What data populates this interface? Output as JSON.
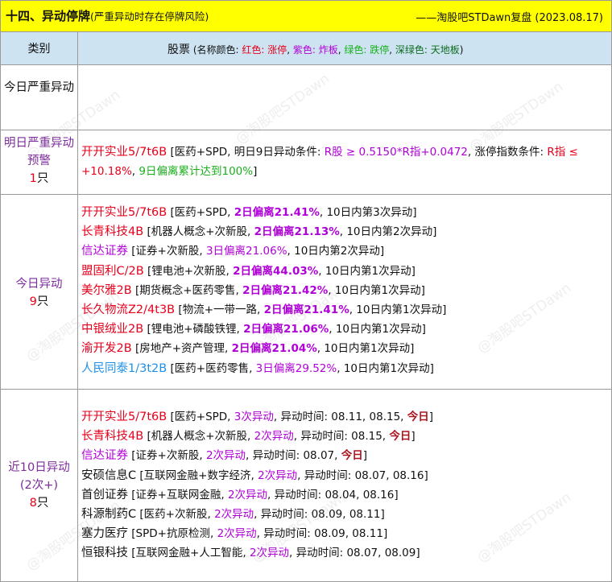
{
  "title": {
    "main": "十四、异动停牌",
    "sub": "(严重异动时存在停牌风险)",
    "source": "——淘股吧STDawn复盘 (2023.08.17)"
  },
  "header": {
    "category": "类别",
    "stocks": "股票",
    "legend": [
      {
        "text": " (名称颜色: ",
        "color": "#111111"
      },
      {
        "text": "红色: 涨停",
        "color": "#e8001b"
      },
      {
        "text": ", ",
        "color": "#111111"
      },
      {
        "text": "紫色: 炸板",
        "color": "#b000d8"
      },
      {
        "text": ", ",
        "color": "#111111"
      },
      {
        "text": "绿色: 跌停",
        "color": "#18b01a"
      },
      {
        "text": ", ",
        "color": "#111111"
      },
      {
        "text": "深绿色: 天地板",
        "color": "#0d6b1e"
      },
      {
        "text": ")",
        "color": "#111111"
      }
    ]
  },
  "watermark": "@淘股吧STDawn",
  "colors": {
    "red": "#e8001b",
    "purple": "#b000d8",
    "green": "#18b01a",
    "cyan": "#1e90e8",
    "dark": "#111111",
    "title_bg": "#ffff00",
    "header_bg": "#cde3f2"
  },
  "sections": [
    {
      "id": "today-severe",
      "category": [
        {
          "text": "今日严重异动",
          "color": "#111111"
        }
      ],
      "lines": []
    },
    {
      "id": "tomorrow-severe",
      "category": [
        {
          "text": "明日严重异动预警",
          "color": "#7d2c9d"
        },
        {
          "text": "\n1",
          "color": "#e8001b"
        },
        {
          "text": "只",
          "color": "#111111"
        }
      ],
      "lines": [
        {
          "wrap": true,
          "segments": [
            {
              "text": "开开实业5/7t6B",
              "color": "#e8001b",
              "name": true
            },
            {
              "text": " [医药+SPD, 明日9日异动条件: ",
              "color": "#111111"
            },
            {
              "text": "R股 ≥ 0.5150*R指+0.0472",
              "color": "#b000d8"
            },
            {
              "text": ", 涨停指数条件: ",
              "color": "#111111"
            },
            {
              "text": "R指 ≤ +10.18%",
              "color": "#e8001b"
            },
            {
              "text": ", ",
              "color": "#111111"
            },
            {
              "text": "9日偏离累计达到100%",
              "color": "#18b01a"
            },
            {
              "text": "]",
              "color": "#111111"
            }
          ]
        }
      ]
    },
    {
      "id": "today-abnormal",
      "category": [
        {
          "text": "今日异动",
          "color": "#7d2c9d"
        },
        {
          "text": "\n9",
          "color": "#e8001b"
        },
        {
          "text": "只",
          "color": "#111111"
        }
      ],
      "lines": [
        {
          "segments": [
            {
              "text": "开开实业5/7t6B",
              "color": "#e8001b",
              "name": true
            },
            {
              "text": " [医药+SPD, ",
              "color": "#111111"
            },
            {
              "text": "2日偏离21.41%",
              "color": "#b000d8",
              "bold": true
            },
            {
              "text": ", 10日内第3次异动]",
              "color": "#111111"
            }
          ]
        },
        {
          "segments": [
            {
              "text": "长青科技4B",
              "color": "#e8001b",
              "name": true
            },
            {
              "text": " [机器人概念+次新股, ",
              "color": "#111111"
            },
            {
              "text": "2日偏离21.13%",
              "color": "#b000d8",
              "bold": true
            },
            {
              "text": ", 10日内第2次异动]",
              "color": "#111111"
            }
          ]
        },
        {
          "segments": [
            {
              "text": "信达证券",
              "color": "#b000d8",
              "name": true
            },
            {
              "text": " [证券+次新股, ",
              "color": "#111111"
            },
            {
              "text": "3日偏离21.06%",
              "color": "#b000d8"
            },
            {
              "text": ", 10日内第2次异动]",
              "color": "#111111"
            }
          ]
        },
        {
          "segments": [
            {
              "text": "盟固利C/2B",
              "color": "#e8001b",
              "name": true
            },
            {
              "text": " [锂电池+次新股, ",
              "color": "#111111"
            },
            {
              "text": "2日偏离44.03%",
              "color": "#b000d8",
              "bold": true
            },
            {
              "text": ", 10日内第1次异动]",
              "color": "#111111"
            }
          ]
        },
        {
          "segments": [
            {
              "text": "美尔雅2B",
              "color": "#e8001b",
              "name": true
            },
            {
              "text": " [期货概念+医药零售, ",
              "color": "#111111"
            },
            {
              "text": "2日偏离21.42%",
              "color": "#b000d8",
              "bold": true
            },
            {
              "text": ", 10日内第1次异动]",
              "color": "#111111"
            }
          ]
        },
        {
          "segments": [
            {
              "text": "长久物流Z2/4t3B",
              "color": "#e8001b",
              "name": true
            },
            {
              "text": " [物流+一带一路, ",
              "color": "#111111"
            },
            {
              "text": "2日偏离21.41%",
              "color": "#b000d8",
              "bold": true
            },
            {
              "text": ", 10日内第1次异动]",
              "color": "#111111"
            }
          ]
        },
        {
          "segments": [
            {
              "text": "中银绒业2B",
              "color": "#e8001b",
              "name": true
            },
            {
              "text": " [锂电池+磷酸铁锂, ",
              "color": "#111111"
            },
            {
              "text": "2日偏离21.06%",
              "color": "#b000d8",
              "bold": true
            },
            {
              "text": ", 10日内第1次异动]",
              "color": "#111111"
            }
          ]
        },
        {
          "segments": [
            {
              "text": "渝开发2B",
              "color": "#e8001b",
              "name": true
            },
            {
              "text": " [房地产+资产管理, ",
              "color": "#111111"
            },
            {
              "text": "2日偏离21.04%",
              "color": "#b000d8",
              "bold": true
            },
            {
              "text": ", 10日内第1次异动]",
              "color": "#111111"
            }
          ]
        },
        {
          "segments": [
            {
              "text": "人民同泰1/3t2B",
              "color": "#1e90e8",
              "name": true
            },
            {
              "text": " [医药+医药零售, ",
              "color": "#111111"
            },
            {
              "text": "3日偏离29.52%",
              "color": "#b000d8"
            },
            {
              "text": ", 10日内第1次异动]",
              "color": "#111111"
            }
          ]
        }
      ]
    },
    {
      "id": "recent-10day",
      "category": [
        {
          "text": "近10日异动\n(2次+)",
          "color": "#7d2c9d"
        },
        {
          "text": "\n8",
          "color": "#e8001b"
        },
        {
          "text": "只",
          "color": "#111111"
        }
      ],
      "lines": [
        {
          "segments": [
            {
              "text": "开开实业5/7t6B",
              "color": "#e8001b",
              "name": true
            },
            {
              "text": " [医药+SPD, ",
              "color": "#111111"
            },
            {
              "text": "3次异动",
              "color": "#b000d8"
            },
            {
              "text": ", 异动时间: 08.11, 08.15, ",
              "color": "#111111"
            },
            {
              "text": "今日",
              "color": "#a8141c",
              "bold": true
            },
            {
              "text": "]",
              "color": "#111111"
            }
          ]
        },
        {
          "segments": [
            {
              "text": "长青科技4B",
              "color": "#e8001b",
              "name": true
            },
            {
              "text": " [机器人概念+次新股, ",
              "color": "#111111"
            },
            {
              "text": "2次异动",
              "color": "#b000d8"
            },
            {
              "text": ", 异动时间: 08.15, ",
              "color": "#111111"
            },
            {
              "text": "今日",
              "color": "#a8141c",
              "bold": true
            },
            {
              "text": "]",
              "color": "#111111"
            }
          ]
        },
        {
          "segments": [
            {
              "text": "信达证券",
              "color": "#b000d8",
              "name": true
            },
            {
              "text": " [证券+次新股, ",
              "color": "#111111"
            },
            {
              "text": "2次异动",
              "color": "#b000d8"
            },
            {
              "text": ", 异动时间: 08.07, ",
              "color": "#111111"
            },
            {
              "text": "今日",
              "color": "#a8141c",
              "bold": true
            },
            {
              "text": "]",
              "color": "#111111"
            }
          ]
        },
        {
          "segments": [
            {
              "text": "安硕信息C",
              "color": "#111111",
              "name": true
            },
            {
              "text": " [互联网金融+数字经济, ",
              "color": "#111111"
            },
            {
              "text": "2次异动",
              "color": "#b000d8"
            },
            {
              "text": ", 异动时间: 08.07, 08.16]",
              "color": "#111111"
            }
          ]
        },
        {
          "segments": [
            {
              "text": "首创证券",
              "color": "#111111",
              "name": true
            },
            {
              "text": " [证券+互联网金融, ",
              "color": "#111111"
            },
            {
              "text": "2次异动",
              "color": "#b000d8"
            },
            {
              "text": ", 异动时间: 08.04, 08.16]",
              "color": "#111111"
            }
          ]
        },
        {
          "segments": [
            {
              "text": "科源制药C",
              "color": "#111111",
              "name": true
            },
            {
              "text": " [医药+次新股, ",
              "color": "#111111"
            },
            {
              "text": "2次异动",
              "color": "#b000d8"
            },
            {
              "text": ", 异动时间: 08.09, 08.11]",
              "color": "#111111"
            }
          ]
        },
        {
          "segments": [
            {
              "text": "塞力医疗",
              "color": "#111111",
              "name": true
            },
            {
              "text": " [SPD+抗原检测, ",
              "color": "#111111"
            },
            {
              "text": "2次异动",
              "color": "#b000d8"
            },
            {
              "text": ", 异动时间: 08.09, 08.11]",
              "color": "#111111"
            }
          ]
        },
        {
          "segments": [
            {
              "text": "恒银科技",
              "color": "#111111",
              "name": true
            },
            {
              "text": " [互联网金融+人工智能, ",
              "color": "#111111"
            },
            {
              "text": "2次异动",
              "color": "#b000d8"
            },
            {
              "text": ", 异动时间: 08.07, 08.09]",
              "color": "#111111"
            }
          ]
        }
      ]
    }
  ]
}
